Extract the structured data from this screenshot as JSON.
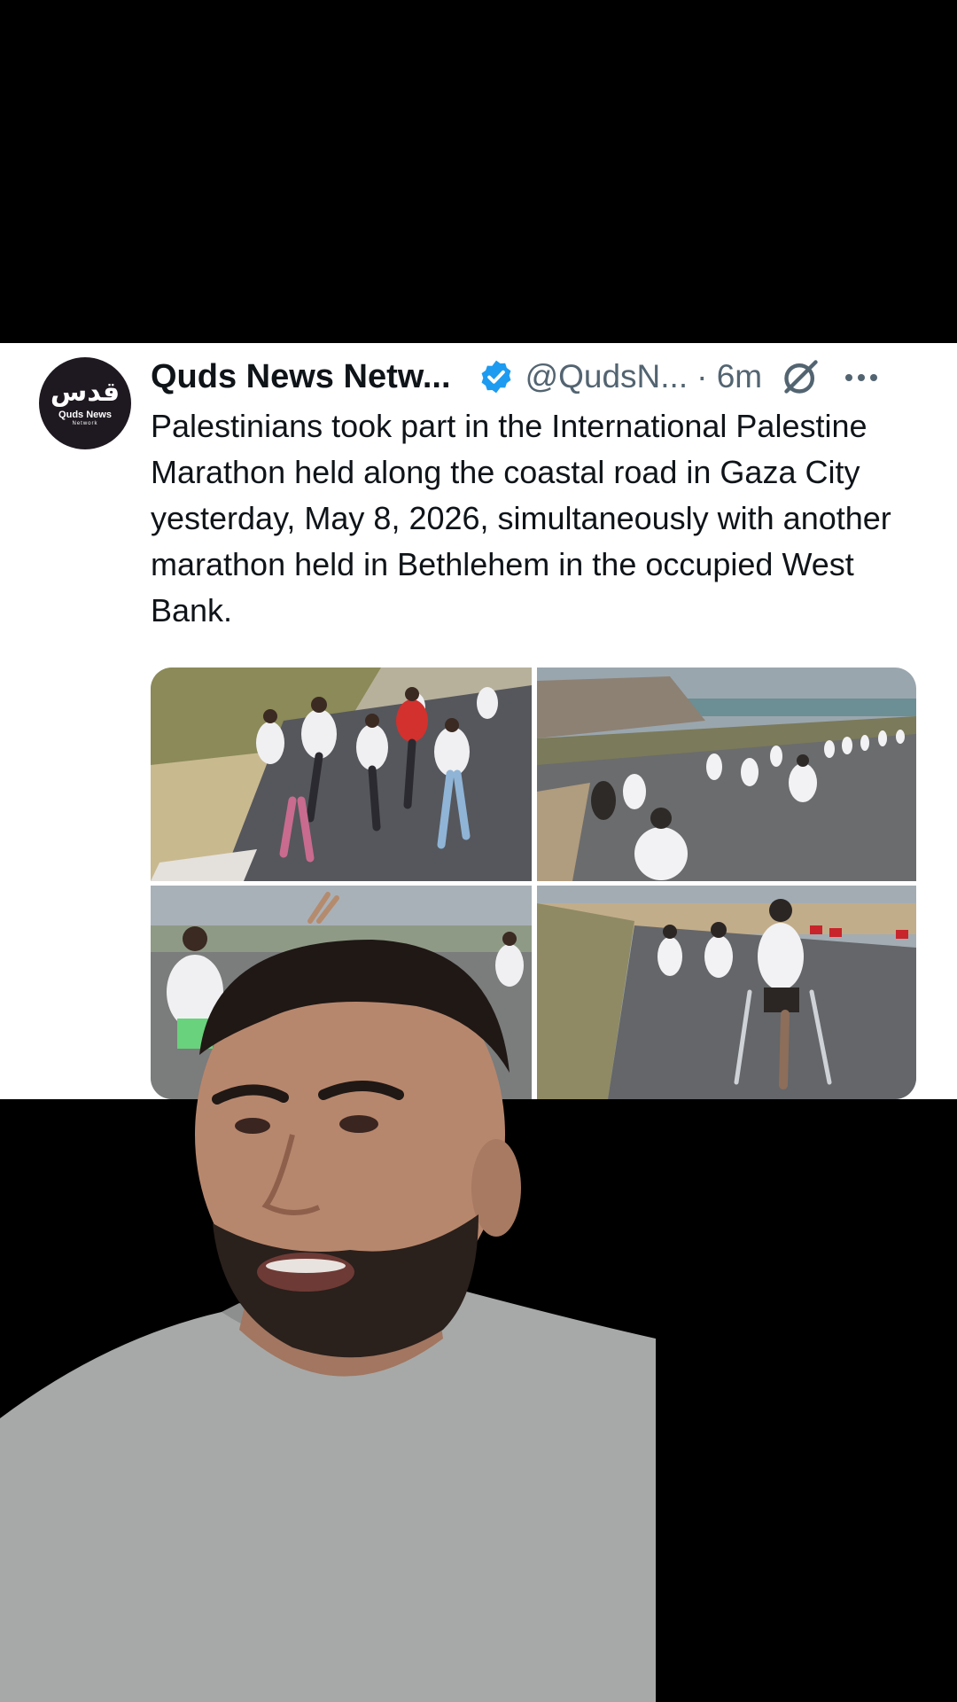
{
  "post": {
    "avatar": {
      "logo_text": "قدس",
      "subtitle": "Quds News",
      "subtitle2": "Network"
    },
    "author_name": "Quds News Netw...",
    "verified": true,
    "handle": "@QudsN...",
    "time": "· 6m",
    "text": "Palestinians took part in the International Palestine Marathon held along the coastal road in Gaza City yesterday, May 8, 2026, simultaneously with another marathon held in Bethlehem in the occupied West Bank.",
    "media_count": 4
  },
  "icons": {
    "verified": "verified-badge-icon",
    "grok": "grok-icon",
    "more": "more-options-icon"
  },
  "colors": {
    "verified_blue": "#1d9bf0",
    "text_primary": "#0f1419",
    "text_secondary": "#536471",
    "background": "#000000",
    "card": "#ffffff"
  }
}
